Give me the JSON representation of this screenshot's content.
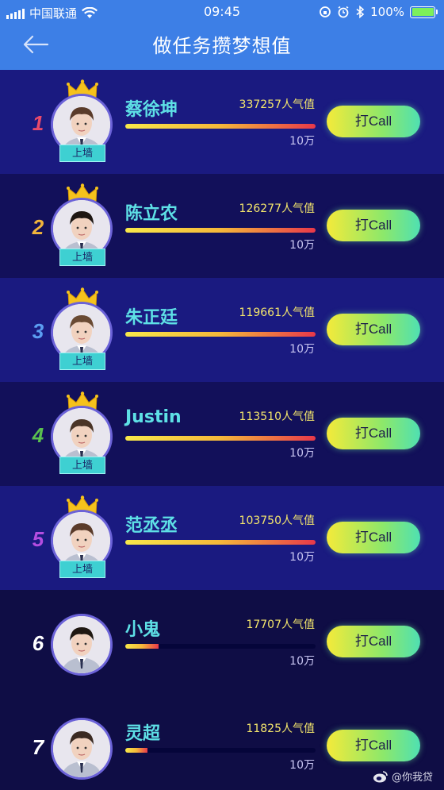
{
  "status_bar": {
    "carrier": "中国联通",
    "time": "09:45",
    "battery": "100%",
    "battery_level": 1.0
  },
  "header": {
    "title": "做任务攒梦想值"
  },
  "colors": {
    "header_bg": "#3d7fe6",
    "name_color": "#5ee0e6",
    "popularity_color": "#f4e66c",
    "call_button_start": "#f4ea3a",
    "call_button_end": "#4fe0b2"
  },
  "list": {
    "goal_label": "10万",
    "unit_label": "人气值",
    "call_label": "打Call",
    "wall_label": "上墙",
    "items": [
      {
        "rank": "1",
        "rank_color": "#e94a6a",
        "name": "蔡徐坤",
        "popularity": "337257",
        "progress": 1.0,
        "on_wall": true
      },
      {
        "rank": "2",
        "rank_color": "#f2b53b",
        "name": "陈立农",
        "popularity": "126277",
        "progress": 1.0,
        "on_wall": true
      },
      {
        "rank": "3",
        "rank_color": "#5b9ef2",
        "name": "朱正廷",
        "popularity": "119661",
        "progress": 1.0,
        "on_wall": true
      },
      {
        "rank": "4",
        "rank_color": "#5ac04f",
        "name": "Justin",
        "popularity": "113510",
        "progress": 1.0,
        "on_wall": true
      },
      {
        "rank": "5",
        "rank_color": "#b44de0",
        "name": "范丞丞",
        "popularity": "103750",
        "progress": 1.0,
        "on_wall": true
      },
      {
        "rank": "6",
        "rank_color": "#ffffff",
        "name": "小鬼",
        "popularity": "17707",
        "progress": 0.177,
        "on_wall": false
      },
      {
        "rank": "7",
        "rank_color": "#ffffff",
        "name": "灵超",
        "popularity": "11825",
        "progress": 0.118,
        "on_wall": false
      }
    ]
  },
  "watermark": {
    "text": "@你我贷",
    "icon": "weibo-icon"
  }
}
